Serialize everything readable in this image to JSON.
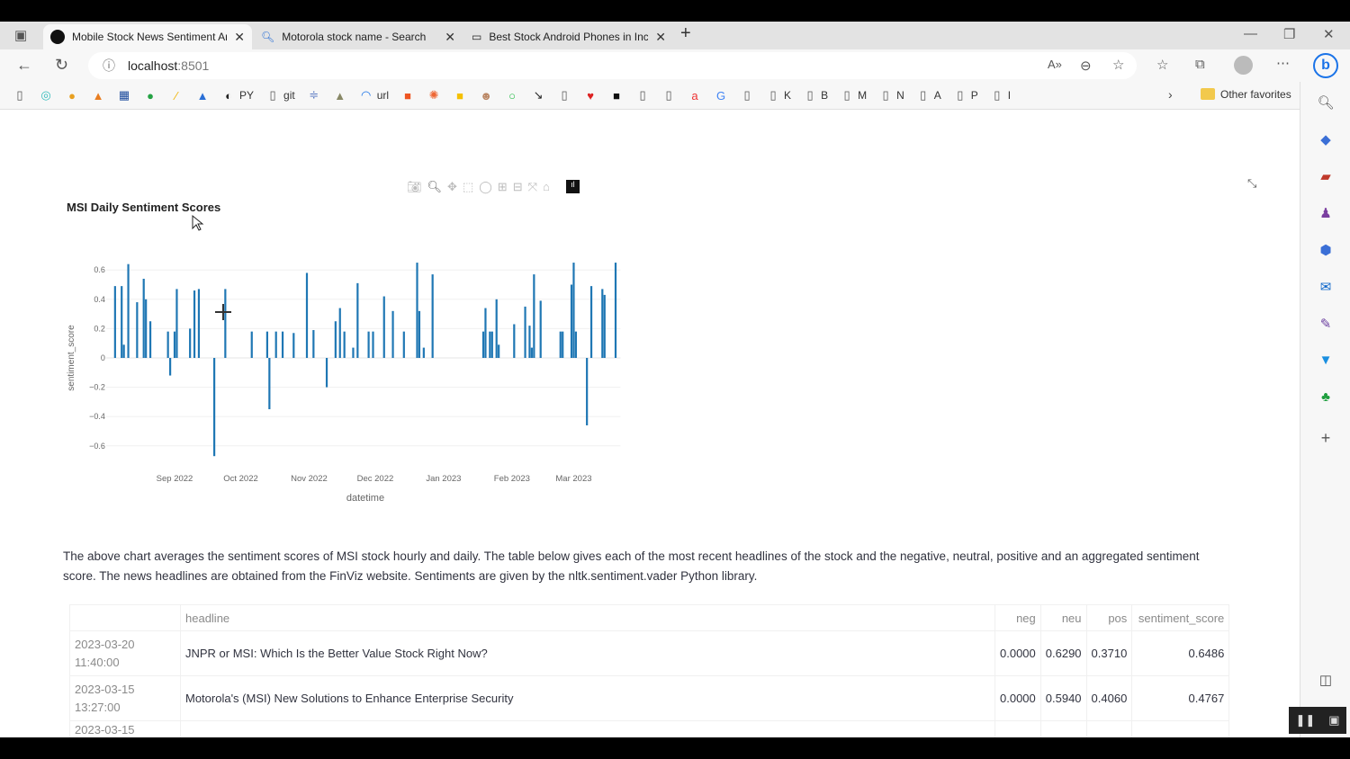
{
  "browser": {
    "tabs": [
      {
        "title": "Mobile Stock News Sentiment Ar",
        "icon": "streamlit-icon"
      },
      {
        "title": "Motorola stock name - Search",
        "icon": "search-icon"
      },
      {
        "title": "Best Stock Android Phones in Inc",
        "icon": "page-icon"
      }
    ],
    "new_tab": "+",
    "url_host": "localhost",
    "url_port": ":8501",
    "bookmarks": [
      "",
      "",
      "",
      "",
      "",
      "",
      "",
      "",
      "PY",
      "git",
      "",
      "",
      "url",
      "",
      "",
      "",
      "",
      "",
      "",
      "",
      "",
      "",
      "",
      "",
      "",
      "",
      "",
      "K",
      "B",
      "M",
      "N",
      "A",
      "P",
      "I"
    ],
    "other_favorites": "Other favorites"
  },
  "chart_data": {
    "type": "bar",
    "title": "MSI Daily Sentiment Scores",
    "xlabel": "datetime",
    "ylabel": "sentiment_score",
    "ylim": [
      -0.68,
      0.66
    ],
    "xlim": [
      "2022-08-03",
      "2023-03-21"
    ],
    "yticks": [
      0.6,
      0.4,
      0.2,
      0,
      -0.2,
      -0.4,
      -0.6
    ],
    "ytick_labels": [
      "0.6",
      "0.4",
      "0.2",
      "0",
      "−0.2",
      "−0.4",
      "−0.6"
    ],
    "xticks": [
      "2022-09-01",
      "2022-10-01",
      "2022-11-01",
      "2022-12-01",
      "2023-01-01",
      "2023-02-01",
      "2023-03-01"
    ],
    "xtick_labels": [
      "Sep 2022",
      "Oct 2022",
      "Nov 2022",
      "Dec 2022",
      "Jan 2023",
      "Feb 2023",
      "Mar 2023"
    ],
    "color": "#1f77b4",
    "x": [
      "2022-08-05",
      "2022-08-08",
      "2022-08-09",
      "2022-08-11",
      "2022-08-15",
      "2022-08-18",
      "2022-08-19",
      "2022-08-21",
      "2022-08-29",
      "2022-08-30",
      "2022-09-01",
      "2022-09-02",
      "2022-09-08",
      "2022-09-10",
      "2022-09-12",
      "2022-09-19",
      "2022-09-24",
      "2022-10-06",
      "2022-10-13",
      "2022-10-14",
      "2022-10-17",
      "2022-10-20",
      "2022-10-25",
      "2022-10-31",
      "2022-11-03",
      "2022-11-09",
      "2022-11-13",
      "2022-11-15",
      "2022-11-17",
      "2022-11-21",
      "2022-11-23",
      "2022-11-28",
      "2022-11-30",
      "2022-12-05",
      "2022-12-09",
      "2022-12-14",
      "2022-12-20",
      "2022-12-21",
      "2022-12-23",
      "2022-12-27",
      "2023-01-19",
      "2023-01-20",
      "2023-01-22",
      "2023-01-23",
      "2023-01-25",
      "2023-01-26",
      "2023-02-02",
      "2023-02-07",
      "2023-02-09",
      "2023-02-10",
      "2023-02-11",
      "2023-02-14",
      "2023-02-23",
      "2023-02-24",
      "2023-02-28",
      "2023-03-01",
      "2023-03-02",
      "2023-03-07",
      "2023-03-09",
      "2023-03-14",
      "2023-03-15",
      "2023-03-20"
    ],
    "values": [
      0.49,
      0.49,
      0.09,
      0.64,
      0.38,
      0.54,
      0.4,
      0.25,
      0.18,
      -0.12,
      0.18,
      0.47,
      0.2,
      0.46,
      0.47,
      -0.67,
      0.47,
      0.18,
      0.18,
      -0.35,
      0.18,
      0.18,
      0.17,
      0.58,
      0.19,
      -0.2,
      0.25,
      0.34,
      0.18,
      0.07,
      0.51,
      0.18,
      0.18,
      0.42,
      0.32,
      0.18,
      0.65,
      0.32,
      0.07,
      0.57,
      0.18,
      0.34,
      0.18,
      0.18,
      0.4,
      0.09,
      0.23,
      0.35,
      0.22,
      0.07,
      0.57,
      0.39,
      0.18,
      0.18,
      0.5,
      0.65,
      0.18,
      -0.46,
      0.49,
      0.47,
      0.43,
      0.65
    ]
  },
  "description": "The above chart averages the sentiment scores of MSI stock hourly and daily. The table below gives each of the most recent headlines of the stock and the negative, neutral, positive and an aggregated sentiment score. The news headlines are obtained from the FinViz website. Sentiments are given by the nltk.sentiment.vader Python library.",
  "table": {
    "columns": [
      "",
      "headline",
      "neg",
      "neu",
      "pos",
      "sentiment_score"
    ],
    "rows": [
      {
        "date": "2023-03-20",
        "time": "11:40:00",
        "headline": "JNPR or MSI: Which Is the Better Value Stock Right Now?",
        "neg": "0.0000",
        "neu": "0.6290",
        "pos": "0.3710",
        "score": "0.6486"
      },
      {
        "date": "2023-03-15",
        "time": "13:27:00",
        "headline": "Motorola's (MSI) New Solutions to Enhance Enterprise Security",
        "neg": "0.0000",
        "neu": "0.5940",
        "pos": "0.4060",
        "score": "0.4767"
      },
      {
        "date": "2023-03-15",
        "time": "",
        "headline": "",
        "neg": "",
        "neu": "",
        "pos": "",
        "score": ""
      }
    ]
  }
}
